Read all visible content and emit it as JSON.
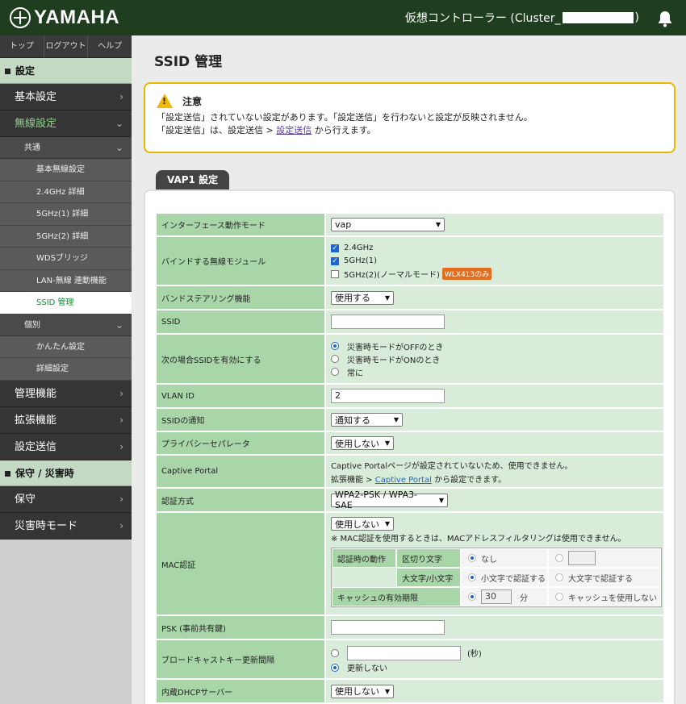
{
  "header": {
    "brand": "YAMAHA",
    "controller": "仮想コントローラー (Cluster_",
    "controller_end": ")"
  },
  "topnav": [
    "トップ",
    "ログアウト",
    "ヘルプ"
  ],
  "sidebar": {
    "sec_settings": "設定",
    "basic": "基本設定",
    "wireless": "無線設定",
    "common": "共通",
    "common_items": [
      "基本無線設定",
      "2.4GHz 詳細",
      "5GHz(1) 詳細",
      "5GHz(2) 詳細",
      "WDSブリッジ",
      "LAN-無線 連動機能",
      "SSID 管理"
    ],
    "individual": "個別",
    "individual_items": [
      "かんたん設定",
      "詳細設定"
    ],
    "mgmt": "管理機能",
    "ext": "拡張機能",
    "send": "設定送信",
    "sec_maint": "保守 / 災害時",
    "maint": "保守",
    "disaster": "災害時モード"
  },
  "page": {
    "title": "SSID 管理"
  },
  "notice": {
    "title": "注意",
    "line1": "「設定送信」されていない設定があります。「設定送信」を行わないと設定が反映されません。",
    "line2_pre": "「設定送信」は、設定送信 > ",
    "line2_link": "設定送信",
    "line2_post": " から行えます。"
  },
  "vap": {
    "tab": "VAP1 設定"
  },
  "form": {
    "iface_label": "インターフェース動作モード",
    "iface_value": "vap",
    "bind_label": "バインドする無線モジュール",
    "bind_opts": [
      "2.4GHz",
      "5GHz(1)",
      "5GHz(2)(ノーマルモード)"
    ],
    "bind_badge": "WLX413のみ",
    "band_label": "バンドステアリング機能",
    "band_value": "使用する",
    "ssid_label": "SSID",
    "ssid_value": "",
    "enable_label": "次の場合SSIDを有効にする",
    "enable_opts": [
      "災害時モードがOFFのとき",
      "災害時モードがONのとき",
      "常に"
    ],
    "vlan_label": "VLAN ID",
    "vlan_value": "2",
    "notify_label": "SSIDの通知",
    "notify_value": "通知する",
    "privacy_label": "プライバシーセパレータ",
    "privacy_value": "使用しない",
    "captive_label": "Captive Portal",
    "captive_line1": "Captive Portalページが設定されていないため、使用できません。",
    "captive_line2_pre": "拡張機能 > ",
    "captive_link": "Captive Portal",
    "captive_line2_post": " から設定できます。",
    "auth_label": "認証方式",
    "auth_value": "WPA2-PSK / WPA3-SAE",
    "mac_label": "MAC認証",
    "mac_value": "使用しない",
    "mac_note": "※ MAC認証を使用するときは、MACアドレスフィルタリングは使用できません。",
    "mac_action": "認証時の動作",
    "mac_delim": "区切り文字",
    "mac_none": "なし",
    "mac_case": "大文字/小文字",
    "mac_lower": "小文字で認証する",
    "mac_upper": "大文字で認証する",
    "mac_cache": "キャッシュの有効期限",
    "mac_cache_val": "30",
    "mac_min": "分",
    "mac_nocache": "キャッシュを使用しない",
    "psk_label": "PSK (事前共有鍵)",
    "psk_value": "",
    "bcast_label": "ブロードキャストキー更新間隔",
    "bcast_unit": "(秒)",
    "bcast_noupdate": "更新しない",
    "dhcp_label": "内蔵DHCPサーバー",
    "dhcp_value": "使用しない"
  }
}
